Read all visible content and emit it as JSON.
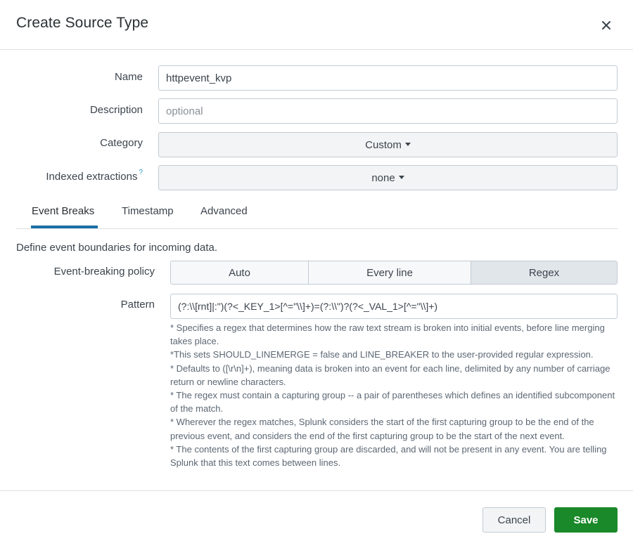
{
  "dialog": {
    "title": "Create Source Type",
    "close_icon": "close-icon"
  },
  "form": {
    "name_label": "Name",
    "name_value": "httpevent_kvp",
    "description_label": "Description",
    "description_placeholder": "optional",
    "category_label": "Category",
    "category_value": "Custom",
    "indexed_label": "Indexed extractions",
    "indexed_help_mark": "?",
    "indexed_value": "none"
  },
  "tabs": [
    {
      "label": "Event Breaks",
      "active": true
    },
    {
      "label": "Timestamp",
      "active": false
    },
    {
      "label": "Advanced",
      "active": false
    }
  ],
  "event_breaks": {
    "description": "Define event boundaries for incoming data.",
    "policy_label": "Event-breaking policy",
    "policy_options": [
      "Auto",
      "Every line",
      "Regex"
    ],
    "policy_selected": "Regex",
    "pattern_label": "Pattern",
    "pattern_value": "(?:\\\\[rnt]|:\")(?<_KEY_1>[^=\"\\\\]+)=(?:\\\\\")?(?<_VAL_1>[^=\"\\\\]+)",
    "help_lines": [
      "* Specifies a regex that determines how the raw text stream is broken into initial events, before line merging takes place.",
      "*This sets SHOULD_LINEMERGE = false and LINE_BREAKER to the user-provided regular expression.",
      "* Defaults to ([\\r\\n]+), meaning data is broken into an event for each line, delimited by any number of carriage return or newline characters.",
      "* The regex must contain a capturing group -- a pair of parentheses which defines an identified subcomponent of the match.",
      "* Wherever the regex matches, Splunk considers the start of the first capturing group to be the end of the previous event, and considers the end of the first capturing group to be the start of the next event.",
      "* The contents of the first capturing group are discarded, and will not be present in any event. You are telling Splunk that this text comes between lines."
    ]
  },
  "footer": {
    "cancel_label": "Cancel",
    "save_label": "Save"
  },
  "colors": {
    "save": "#1a8929",
    "tab_accent": "#1a6fa8",
    "help_mark": "#1e93c6"
  }
}
